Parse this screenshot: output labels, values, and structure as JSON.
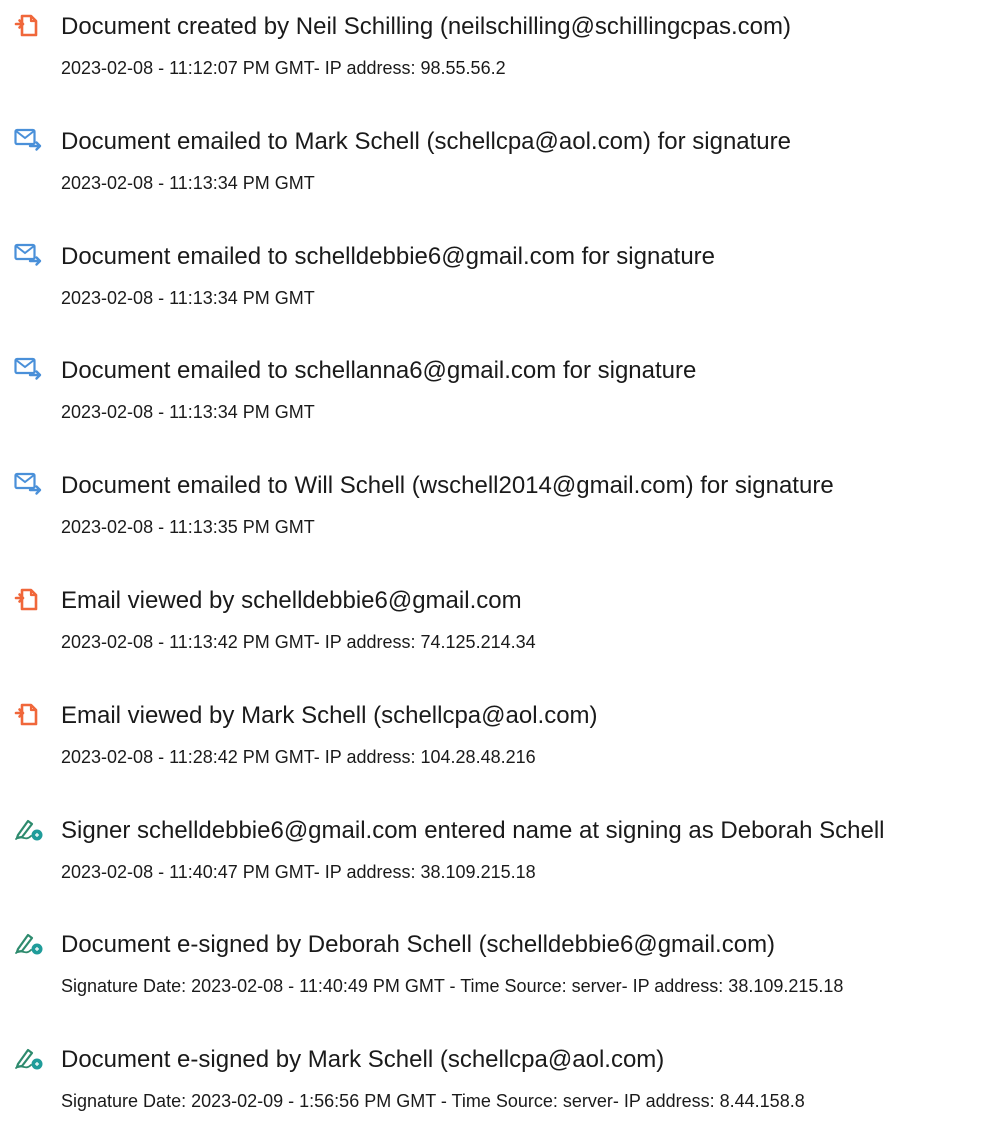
{
  "events": [
    {
      "icon": "document-created-icon",
      "title": "Document created by Neil Schilling (neilschilling@schillingcpas.com)",
      "detail": "2023-02-08 - 11:12:07 PM GMT- IP address: 98.55.56.2"
    },
    {
      "icon": "email-sent-icon",
      "title": "Document emailed to Mark Schell (schellcpa@aol.com) for signature",
      "detail": "2023-02-08 - 11:13:34 PM GMT"
    },
    {
      "icon": "email-sent-icon",
      "title": "Document emailed to schelldebbie6@gmail.com for signature",
      "detail": "2023-02-08 - 11:13:34 PM GMT"
    },
    {
      "icon": "email-sent-icon",
      "title": "Document emailed to schellanna6@gmail.com for signature",
      "detail": "2023-02-08 - 11:13:34 PM GMT"
    },
    {
      "icon": "email-sent-icon",
      "title": "Document emailed to Will Schell (wschell2014@gmail.com) for signature",
      "detail": "2023-02-08 - 11:13:35 PM GMT"
    },
    {
      "icon": "email-viewed-icon",
      "title": "Email viewed by schelldebbie6@gmail.com",
      "detail": "2023-02-08 - 11:13:42 PM GMT- IP address: 74.125.214.34"
    },
    {
      "icon": "email-viewed-icon",
      "title": "Email viewed by Mark Schell (schellcpa@aol.com)",
      "detail": "2023-02-08 - 11:28:42 PM GMT- IP address: 104.28.48.216"
    },
    {
      "icon": "esign-pen-icon",
      "title": "Signer schelldebbie6@gmail.com entered name at signing as Deborah Schell",
      "detail": "2023-02-08 - 11:40:47 PM GMT- IP address: 38.109.215.18"
    },
    {
      "icon": "esign-pen-icon",
      "title": "Document e-signed by Deborah Schell (schelldebbie6@gmail.com)",
      "detail": "Signature Date: 2023-02-08 - 11:40:49 PM GMT - Time Source: server- IP address: 38.109.215.18"
    },
    {
      "icon": "esign-pen-icon",
      "title": "Document e-signed by Mark Schell (schellcpa@aol.com)",
      "detail": "Signature Date: 2023-02-09 - 1:56:56 PM GMT - Time Source: server- IP address: 8.44.158.8"
    }
  ],
  "colors": {
    "document_icon": "#f0673a",
    "email_icon": "#4a90d9",
    "esign_icon_pen": "#2e8b6e",
    "esign_icon_dot": "#1f9c9a",
    "text": "#1a1a1a"
  }
}
